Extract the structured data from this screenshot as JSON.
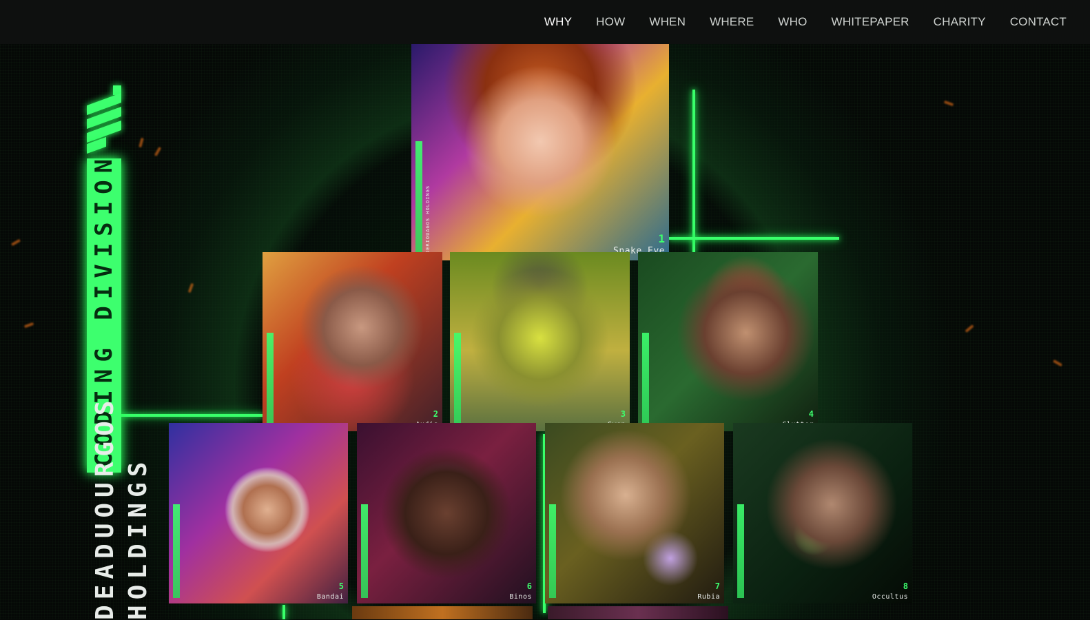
{
  "nav": {
    "items": [
      "WHY",
      "HOW",
      "WHEN",
      "WHERE",
      "WHO",
      "WHITEPAPER",
      "CHARITY",
      "CONTACT"
    ],
    "active": "WHY"
  },
  "brand": {
    "division": "CODING DIVISION",
    "line1": "DEADUOURGOS",
    "line2": "HOLDINGS"
  },
  "cards": [
    {
      "num": "1",
      "name": "Snake Eye"
    },
    {
      "num": "2",
      "name": "Audis"
    },
    {
      "num": "3",
      "name": "Gwen"
    },
    {
      "num": "4",
      "name": "Clutter"
    },
    {
      "num": "5",
      "name": "Bandai"
    },
    {
      "num": "6",
      "name": "Binos"
    },
    {
      "num": "7",
      "name": "Rubia"
    },
    {
      "num": "8",
      "name": "Occultus"
    }
  ],
  "card_side_text": "DERIOUAGOS HOLDINGS",
  "card_side_label": "CODING DIVISION",
  "colors": {
    "accent": "#3dff6e",
    "background": "#050806",
    "nav_bg": "#0e100f"
  }
}
